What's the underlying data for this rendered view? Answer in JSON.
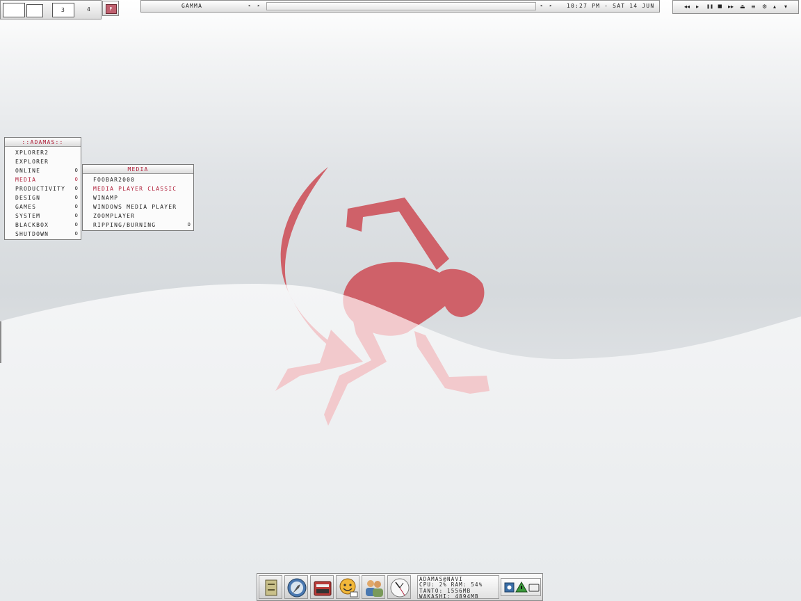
{
  "pager": {
    "workspaces": [
      "",
      "",
      "3",
      "4"
    ],
    "toggle_label": "F"
  },
  "topbar": {
    "workspace_name": "Gamma",
    "prev_workspace": "◂",
    "next_workspace": "▸",
    "prev_window": "◂",
    "next_window": "▸",
    "clock": "10:27 PM - SAT 14 JUN"
  },
  "media_controls": [
    {
      "icon": "prev-track-icon",
      "glyph": "◂◂"
    },
    {
      "icon": "play-icon",
      "glyph": "▸"
    },
    {
      "icon": "pause-icon",
      "glyph": "❚❚"
    },
    {
      "icon": "stop-icon",
      "glyph": "■"
    },
    {
      "icon": "next-track-icon",
      "glyph": "▸▸"
    },
    {
      "icon": "eject-icon",
      "glyph": "⏏"
    },
    {
      "icon": "playlist-icon",
      "glyph": "≡"
    },
    {
      "icon": "settings-icon",
      "glyph": "⚙"
    },
    {
      "icon": "volume-up-icon",
      "glyph": "▴"
    },
    {
      "icon": "volume-down-icon",
      "glyph": "▾"
    }
  ],
  "root_menu": {
    "title": "::ADAMAS::",
    "items": [
      {
        "label": "xplorer2",
        "submenu": false
      },
      {
        "label": "explorer",
        "submenu": false
      },
      {
        "label": "online",
        "submenu": true
      },
      {
        "label": "media",
        "submenu": true,
        "active": true
      },
      {
        "label": "productivity",
        "submenu": true
      },
      {
        "label": "design",
        "submenu": true
      },
      {
        "label": "games",
        "submenu": true
      },
      {
        "label": "system",
        "submenu": true
      },
      {
        "label": "blackbox",
        "submenu": true
      },
      {
        "label": "shutdown",
        "submenu": true
      }
    ]
  },
  "media_menu": {
    "title": "Media",
    "items": [
      {
        "label": "foobar2000",
        "submenu": false
      },
      {
        "label": "media player classic",
        "submenu": false,
        "active": true
      },
      {
        "label": "winamp",
        "submenu": false
      },
      {
        "label": "windows media player",
        "submenu": false
      },
      {
        "label": "zoomplayer",
        "submenu": false
      },
      {
        "label": "ripping/burning",
        "submenu": true
      }
    ]
  },
  "submenu_marker": "o",
  "dock": {
    "icons": [
      "drawer-icon",
      "browser-compass-icon",
      "typewriter-icon",
      "messenger-smiley-icon",
      "contacts-people-icon",
      "analog-clock-icon"
    ],
    "sysinfo": [
      "adamas@navi",
      "cpu: 2% ram: 54%",
      "tanto: 1556mb",
      "wakashi: 4894mb"
    ],
    "tray_icons": [
      "network-icon",
      "alert-triangle-icon",
      "display-icon"
    ]
  },
  "colors": {
    "accent": "#b0203a",
    "wallpaper_figure": "#cf6169"
  }
}
